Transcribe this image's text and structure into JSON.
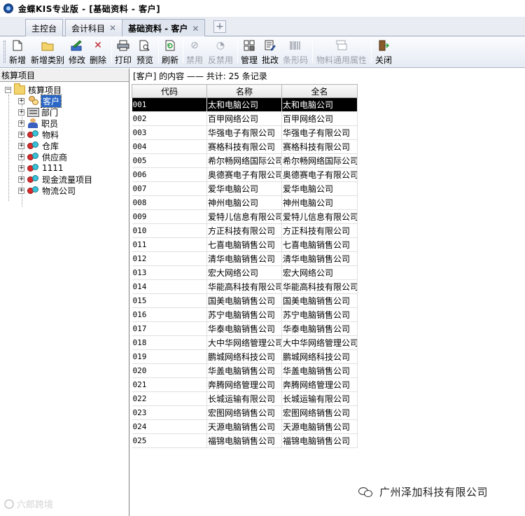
{
  "app": {
    "title": "金蝶KIS专业版 - [基础资料 - 客户]"
  },
  "tabs": [
    {
      "label": "主控台",
      "closable": false,
      "active": false
    },
    {
      "label": "会计科目",
      "closable": true,
      "active": false
    },
    {
      "label": "基础资料 - 客户",
      "closable": true,
      "active": true
    }
  ],
  "toolbar": {
    "buttons": [
      {
        "label": "新增",
        "icon": "new-doc-icon",
        "enabled": true
      },
      {
        "label": "新增类别",
        "icon": "new-folder-icon",
        "enabled": true
      },
      {
        "label": "修改",
        "icon": "edit-icon",
        "enabled": true
      },
      {
        "label": "删除",
        "icon": "delete-icon",
        "enabled": true
      },
      {
        "label": "打印",
        "icon": "print-icon",
        "enabled": true
      },
      {
        "label": "预览",
        "icon": "preview-icon",
        "enabled": true
      },
      {
        "label": "刷新",
        "icon": "refresh-icon",
        "enabled": true
      },
      {
        "label": "禁用",
        "icon": "disable-icon",
        "enabled": false
      },
      {
        "label": "反禁用",
        "icon": "enable-icon",
        "enabled": false
      },
      {
        "label": "管理",
        "icon": "manage-icon",
        "enabled": true
      },
      {
        "label": "批改",
        "icon": "batch-edit-icon",
        "enabled": true
      },
      {
        "label": "条形码",
        "icon": "barcode-icon",
        "enabled": false
      },
      {
        "label": "物料通用属性",
        "icon": "material-attr-icon",
        "enabled": false
      },
      {
        "label": "关闭",
        "icon": "exit-icon",
        "enabled": true
      }
    ]
  },
  "tree": {
    "header": "核算项目",
    "root": "核算项目",
    "items": [
      {
        "label": "客户",
        "icon": "customer-icon",
        "selected": true
      },
      {
        "label": "部门",
        "icon": "department-icon",
        "selected": false
      },
      {
        "label": "职员",
        "icon": "employee-icon",
        "selected": false
      },
      {
        "label": "物料",
        "icon": "item-class-icon",
        "selected": false
      },
      {
        "label": "仓库",
        "icon": "item-class-icon",
        "selected": false
      },
      {
        "label": "供应商",
        "icon": "item-class-icon",
        "selected": false
      },
      {
        "label": "1111",
        "icon": "item-class-icon",
        "selected": false
      },
      {
        "label": "现金流量项目",
        "icon": "item-class-icon",
        "selected": false
      },
      {
        "label": "物流公司",
        "icon": "item-class-icon",
        "selected": false
      }
    ]
  },
  "content": {
    "header": "[客户] 的内容 —— 共计: 25 条记录",
    "columns": [
      "代码",
      "名称",
      "全名"
    ],
    "rows": [
      [
        "001",
        "太和电脑公司",
        "太和电脑公司"
      ],
      [
        "002",
        "百甲网络公司",
        "百甲网络公司"
      ],
      [
        "003",
        "华强电子有限公司",
        "华强电子有限公司"
      ],
      [
        "004",
        "赛格科技有限公司",
        "赛格科技有限公司"
      ],
      [
        "005",
        "希尔畅网络国际公司",
        "希尔畅网络国际公司"
      ],
      [
        "006",
        "奥德赛电子有限公司",
        "奥德赛电子有限公司"
      ],
      [
        "007",
        "爱华电脑公司",
        "爱华电脑公司"
      ],
      [
        "008",
        "神州电脑公司",
        "神州电脑公司"
      ],
      [
        "009",
        "爱特儿信息有限公司",
        "爱特儿信息有限公司"
      ],
      [
        "010",
        "方正科技有限公司",
        "方正科技有限公司"
      ],
      [
        "011",
        "七喜电脑销售公司",
        "七喜电脑销售公司"
      ],
      [
        "012",
        "清华电脑销售公司",
        "清华电脑销售公司"
      ],
      [
        "013",
        "宏大网络公司",
        "宏大网络公司"
      ],
      [
        "014",
        "华能高科技有限公司",
        "华能高科技有限公司"
      ],
      [
        "015",
        "国美电脑销售公司",
        "国美电脑销售公司"
      ],
      [
        "016",
        "苏宁电脑销售公司",
        "苏宁电脑销售公司"
      ],
      [
        "017",
        "华泰电脑销售公司",
        "华泰电脑销售公司"
      ],
      [
        "018",
        "大中华网络管理公司",
        "大中华网络管理公司"
      ],
      [
        "019",
        "鹏城网络科技公司",
        "鹏城网络科技公司"
      ],
      [
        "020",
        "华盖电脑销售公司",
        "华盖电脑销售公司"
      ],
      [
        "021",
        "奔腾网络管理公司",
        "奔腾网络管理公司"
      ],
      [
        "022",
        "长城运输有限公司",
        "长城运输有限公司"
      ],
      [
        "023",
        "宏图网络销售公司",
        "宏图网络销售公司"
      ],
      [
        "024",
        "天源电脑销售公司",
        "天源电脑销售公司"
      ],
      [
        "025",
        "福锦电脑销售公司",
        "福锦电脑销售公司"
      ]
    ],
    "selected_row": 0
  },
  "watermark": {
    "left": "六郎跨境",
    "right": "广州泽加科技有限公司"
  }
}
